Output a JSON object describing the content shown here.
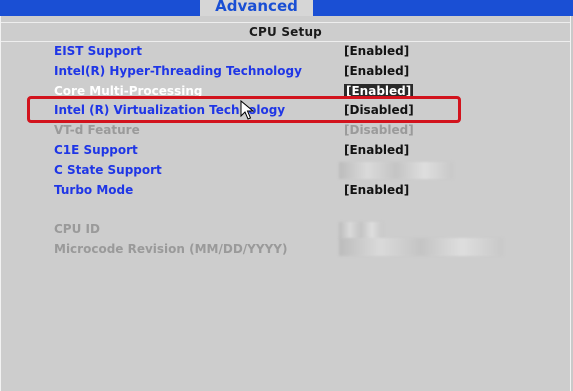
{
  "menu": {
    "active_tab": "Advanced"
  },
  "section": {
    "title": "CPU Setup"
  },
  "settings": [
    {
      "label": "EIST Support",
      "value": "[Enabled]"
    },
    {
      "label": "Intel(R) Hyper-Threading Technology",
      "value": "[Enabled]"
    },
    {
      "label": "Core Multi-Processing",
      "value": "[Enabled]"
    },
    {
      "label": "Intel (R) Virtualization Technology",
      "value": "[Disabled]"
    },
    {
      "label": "VT-d Feature",
      "value": "[Disabled]"
    },
    {
      "label": "C1E Support",
      "value": "[Enabled]"
    },
    {
      "label": "C State Support",
      "value": ""
    },
    {
      "label": "Turbo Mode",
      "value": "[Enabled]"
    }
  ],
  "info": [
    {
      "label": "CPU ID",
      "value": ""
    },
    {
      "label": "Microcode Revision (MM/DD/YYYY)",
      "value": ""
    }
  ],
  "colors": {
    "menu_bar": "#1a4fd4",
    "item_label": "#1f36e6",
    "annotation": "#d2131d"
  }
}
